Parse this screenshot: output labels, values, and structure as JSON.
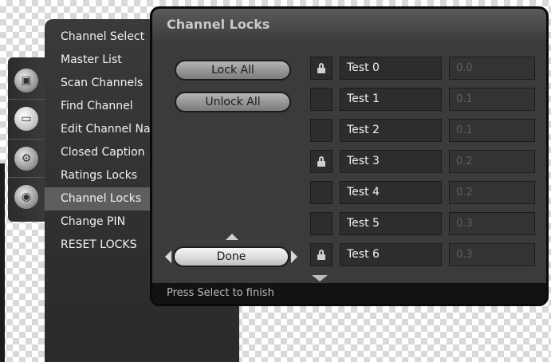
{
  "side_menu": {
    "items": [
      {
        "label": "Channel Select"
      },
      {
        "label": "Master List"
      },
      {
        "label": "Scan Channels"
      },
      {
        "label": "Find Channel"
      },
      {
        "label": "Edit Channel Na"
      },
      {
        "label": "Closed Caption"
      },
      {
        "label": "Ratings Locks"
      },
      {
        "label": "Channel Locks",
        "selected": true
      },
      {
        "label": "Change PIN"
      },
      {
        "label": "RESET LOCKS"
      }
    ]
  },
  "icons": {
    "column": [
      {
        "name": "picture-settings-icon"
      },
      {
        "name": "tv-icon",
        "selected": true
      },
      {
        "name": "setup-gear-icon"
      },
      {
        "name": "camera-icon"
      }
    ]
  },
  "dialog": {
    "title": "Channel Locks",
    "lock_all_label": "Lock All",
    "unlock_all_label": "Unlock All",
    "done_label": "Done",
    "footer_text": "Press Select to finish",
    "channels": [
      {
        "locked": true,
        "name": "Test 0",
        "number": "0.0"
      },
      {
        "locked": false,
        "name": "Test 1",
        "number": "0.1"
      },
      {
        "locked": false,
        "name": "Test 2",
        "number": "0.1"
      },
      {
        "locked": true,
        "name": "Test 3",
        "number": "0.2"
      },
      {
        "locked": false,
        "name": "Test 4",
        "number": "0.2"
      },
      {
        "locked": false,
        "name": "Test 5",
        "number": "0.3"
      },
      {
        "locked": true,
        "name": "Test 6",
        "number": "0.3"
      }
    ]
  }
}
